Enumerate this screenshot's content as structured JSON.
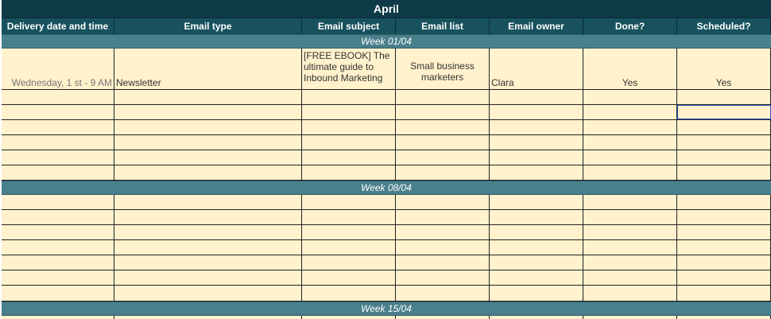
{
  "sheet": {
    "title": "April",
    "columns": [
      "Delivery date and time",
      "Email type",
      "Email subject",
      "Email list",
      "Email owner",
      "Done?",
      "Scheduled?"
    ],
    "weeks": [
      "Week  01/04",
      "Week 08/04",
      "Week  15/04"
    ],
    "first_entry": {
      "delivery": "Wednesday, 1 st - 9 AM",
      "type": "Newsletter",
      "subject": "[FREE EBOOK] The ultimate guide to Inbound Marketing",
      "list": "Small business marketers",
      "owner": "Clara",
      "done": "Yes",
      "scheduled": "Yes"
    }
  }
}
